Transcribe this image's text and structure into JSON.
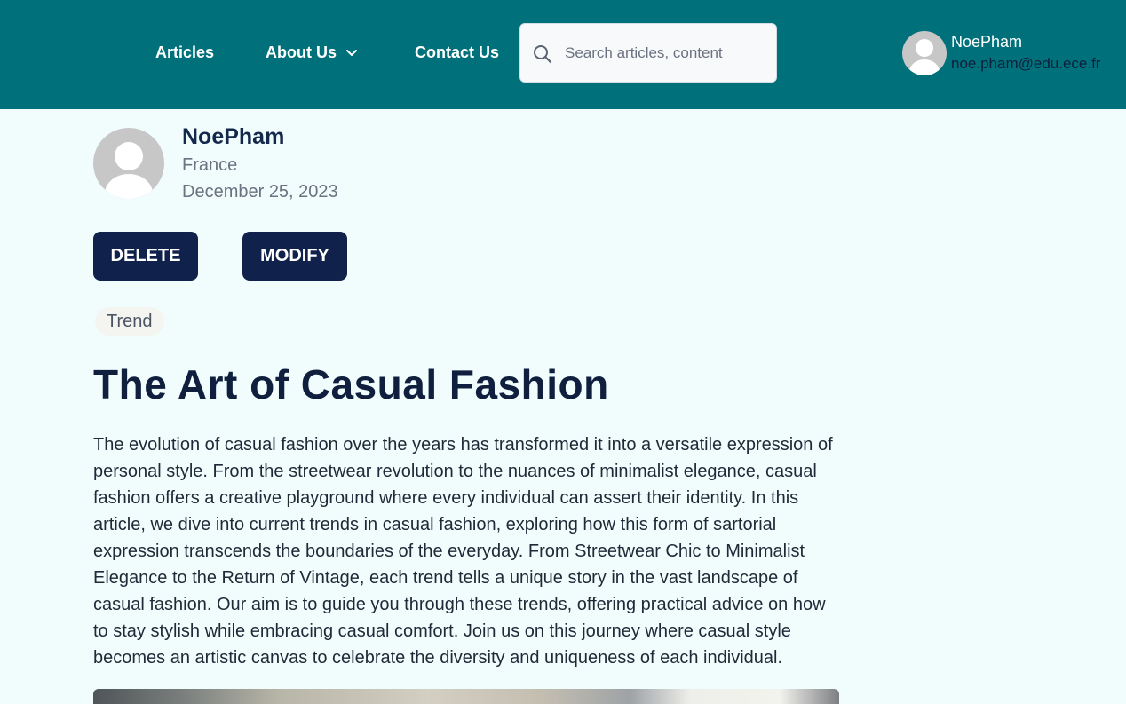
{
  "nav": {
    "articles": "Articles",
    "about": "About Us",
    "contact": "Contact Us"
  },
  "search": {
    "placeholder": "Search articles, content",
    "value": ""
  },
  "user": {
    "name": "NoePham",
    "email": "noe.pham@edu.ece.fr"
  },
  "author": {
    "name": "NoePham",
    "country": "France",
    "date": "December 25, 2023"
  },
  "actions": {
    "delete": "DELETE",
    "modify": "MODIFY"
  },
  "article": {
    "tag": "Trend",
    "title": "The Art of Casual Fashion",
    "body": "The evolution of casual fashion over the years has transformed it into a versatile expression of personal style. From the streetwear revolution to the nuances of minimalist elegance, casual fashion offers a creative playground where every individual can assert their identity. In this article, we dive into current trends in casual fashion, exploring how this form of sartorial expression transcends the boundaries of the everyday. From Streetwear Chic to Minimalist Elegance to the Return of Vintage, each trend tells a unique story in the vast landscape of casual fashion. Our aim is to guide you through these trends, offering practical advice on how to stay stylish while embracing casual comfort. Join us on this journey where casual style becomes an artistic canvas to celebrate the diversity and uniqueness of each individual."
  },
  "colors": {
    "header": "#00717a",
    "background": "#f1fdfd",
    "button": "#10224b",
    "title": "#0f1f3d"
  },
  "icons": {
    "search": "search-icon",
    "chevron": "chevron-down-icon",
    "avatar": "user-avatar-icon"
  }
}
